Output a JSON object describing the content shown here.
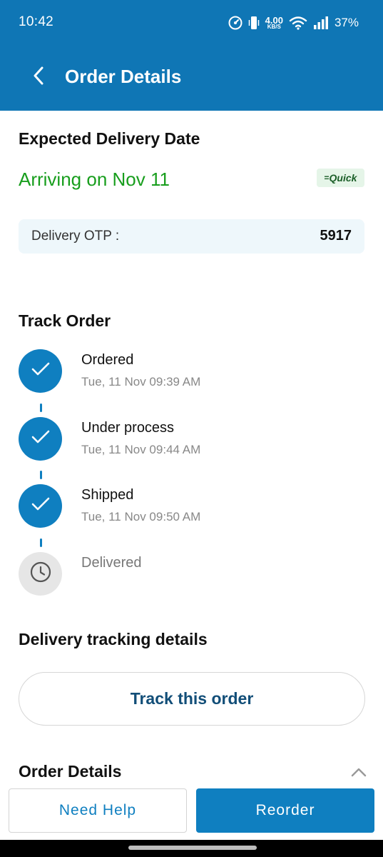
{
  "status_bar": {
    "time": "10:42",
    "net_speed_value": "4.00",
    "net_speed_unit": "KB/S",
    "battery": "37%"
  },
  "header": {
    "title": "Order Details"
  },
  "delivery": {
    "heading": "Expected Delivery Date",
    "arriving": "Arriving on Nov 11",
    "badge_mark": "=",
    "badge": "Quick",
    "otp_label": "Delivery OTP :",
    "otp_value": "5917"
  },
  "track": {
    "heading": "Track Order",
    "steps": [
      {
        "label": "Ordered",
        "time": "Tue, 11 Nov 09:39 AM",
        "done": true
      },
      {
        "label": "Under process",
        "time": "Tue, 11 Nov 09:44 AM",
        "done": true
      },
      {
        "label": "Shipped",
        "time": "Tue, 11 Nov 09:50 AM",
        "done": true
      },
      {
        "label": "Delivered",
        "time": "",
        "done": false
      }
    ]
  },
  "tracking_details": {
    "heading": "Delivery tracking details",
    "button": "Track this order"
  },
  "order_details": {
    "heading": "Order Details"
  },
  "actions": {
    "need_help": "Need Help",
    "reorder": "Reorder"
  },
  "colors": {
    "header_bg": "#0f76b5",
    "accent": "#0f7fc0",
    "arriving_green": "#189e1d",
    "otp_bg": "#eef7fb"
  }
}
